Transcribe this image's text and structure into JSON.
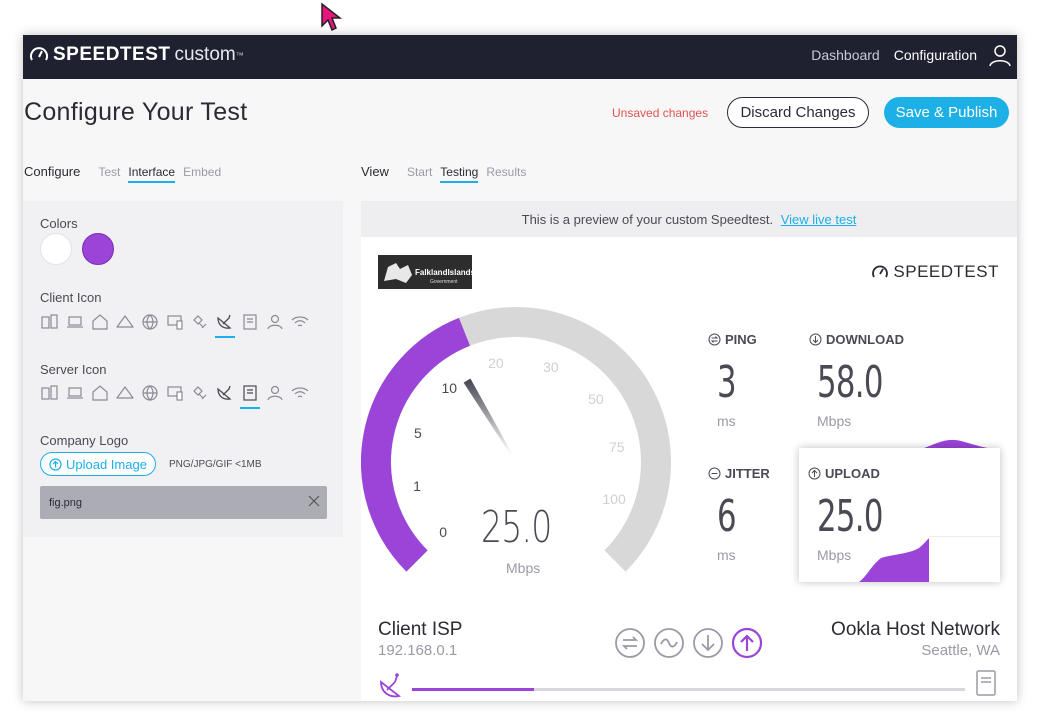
{
  "app": {
    "brand_bold": "SPEEDTEST",
    "brand_light": "custom",
    "nav": {
      "dashboard": "Dashboard",
      "configuration": "Configuration"
    }
  },
  "header": {
    "title": "Configure Your Test",
    "unsaved": "Unsaved changes",
    "discard_label": "Discard Changes",
    "save_label": "Save & Publish"
  },
  "configure_tabs": {
    "lead": "Configure",
    "tabs": [
      "Test",
      "Interface",
      "Embed"
    ],
    "active": "Interface"
  },
  "view_tabs": {
    "lead": "View",
    "tabs": [
      "Start",
      "Testing",
      "Results"
    ],
    "active": "Testing"
  },
  "left_panel": {
    "colors_label": "Colors",
    "colors": [
      "#ffffff",
      "#9b44d8"
    ],
    "client_icon_label": "Client Icon",
    "server_icon_label": "Server Icon",
    "icons": [
      "desktop-icon",
      "laptop-icon",
      "home-icon",
      "cloud-icon",
      "globe-icon",
      "devices-icon",
      "satellite-icon",
      "dish-icon",
      "server-icon",
      "person-icon",
      "wifi-icon"
    ],
    "client_icon_selected": "dish-icon",
    "server_icon_selected": "server-icon",
    "company_logo_label": "Company Logo",
    "upload_label": "Upload Image",
    "format_note": "PNG/JPG/GIF <1MB",
    "file_name": "fig.png"
  },
  "preview": {
    "notice": "This is a preview of your custom Speedtest.",
    "live_link": "View live test",
    "brand": "SPEEDTEST",
    "logo_line1": "FalklandIslands",
    "logo_line2": "Government",
    "gauge": {
      "value": "25.0",
      "unit": "Mbps",
      "ticks": [
        "0",
        "1",
        "5",
        "10",
        "20",
        "30",
        "50",
        "75",
        "100"
      ],
      "max_fraction": 0.42
    },
    "ping": {
      "label": "PING",
      "value": "3",
      "unit": "ms"
    },
    "download": {
      "label": "DOWNLOAD",
      "value": "58.0",
      "unit": "Mbps"
    },
    "jitter": {
      "label": "JITTER",
      "value": "6",
      "unit": "ms"
    },
    "upload": {
      "label": "UPLOAD",
      "value": "25.0",
      "unit": "Mbps"
    },
    "client_isp": "Client ISP",
    "client_ip": "192.168.0.1",
    "host_name": "Ookla Host Network",
    "host_location": "Seattle, WA",
    "progress": 0.22,
    "colors": {
      "accent": "#9b44d8",
      "track": "#d8d8d8",
      "link": "#1cb0e6"
    }
  }
}
